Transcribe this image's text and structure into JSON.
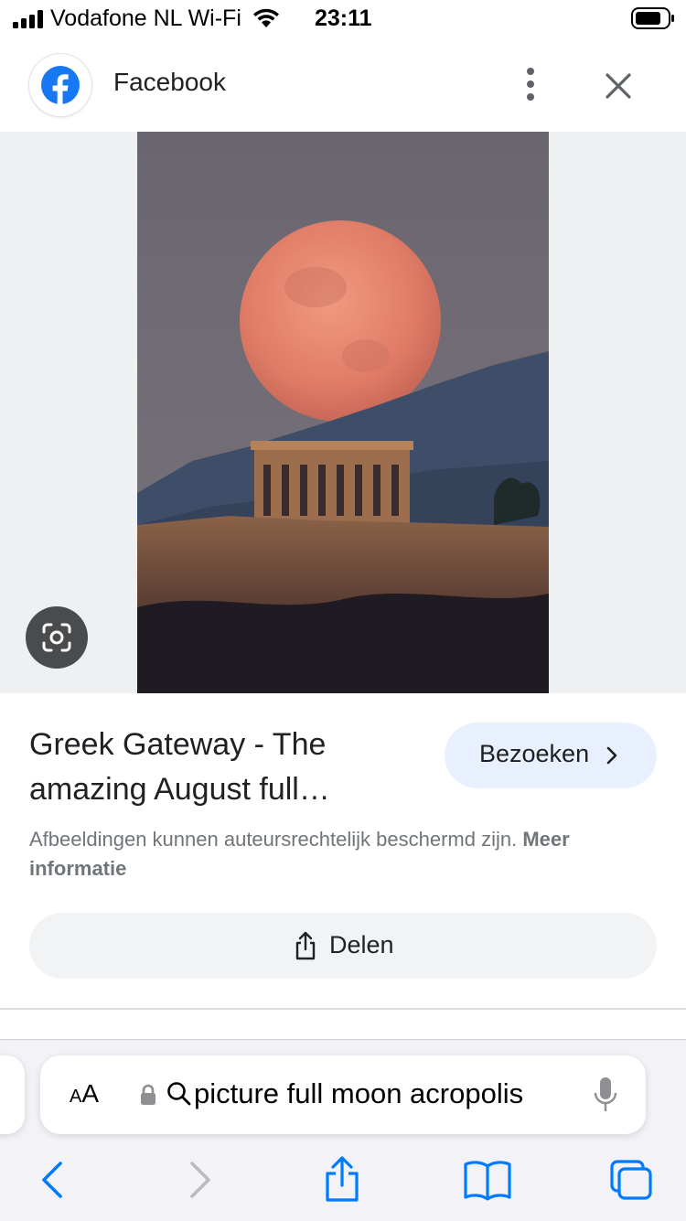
{
  "status_bar": {
    "carrier": "Vodafone NL Wi-Fi",
    "time": "23:11"
  },
  "header": {
    "site_name": "Facebook",
    "logo_icon": "facebook-logo",
    "more_icon": "vertical-dots-icon",
    "close_icon": "close-icon"
  },
  "result": {
    "title": "Greek Gateway - The amazing August full…",
    "visit_label": "Bezoeken",
    "copyright_text": "Afbeeldingen kunnen auteursrechtelijk beschermd zijn.",
    "more_info": "Meer informatie",
    "share_label": "Delen"
  },
  "browser": {
    "text_size_label_small": "A",
    "text_size_label_large": "A",
    "address_text": "picture full moon acropolis"
  },
  "colors": {
    "accent_blue": "#1877f2",
    "ios_blue": "#007aff",
    "visit_button_bg": "#e8f0fe"
  }
}
